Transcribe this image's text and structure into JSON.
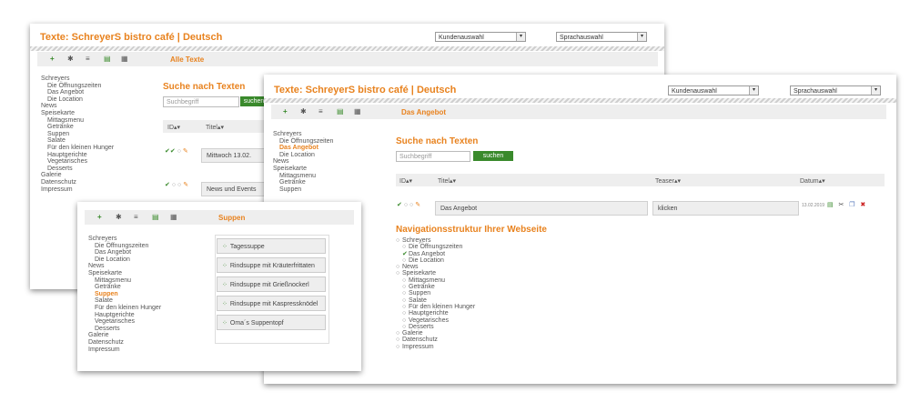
{
  "back_window": {
    "title": "Texte: SchreyerS bistro café | Deutsch",
    "customer_select": "Kundenauswahl",
    "language_select": "Sprachauswahl",
    "toolbar_title": "Alle Texte",
    "nav": [
      {
        "label": "Schreyers",
        "level": 1
      },
      {
        "label": "Die Öffnungszeiten",
        "level": 2
      },
      {
        "label": "Das Angebot",
        "level": 2
      },
      {
        "label": "Die Location",
        "level": 2
      },
      {
        "label": "News",
        "level": 1
      },
      {
        "label": "Speisekarte",
        "level": 1
      },
      {
        "label": "Mittagsmenu",
        "level": 2
      },
      {
        "label": "Getränke",
        "level": 2
      },
      {
        "label": "Suppen",
        "level": 2
      },
      {
        "label": "Salate",
        "level": 2
      },
      {
        "label": "Für den kleinen Hunger",
        "level": 2
      },
      {
        "label": "Hauptgerichte",
        "level": 2
      },
      {
        "label": "Vegetarisches",
        "level": 2
      },
      {
        "label": "Desserts",
        "level": 2
      },
      {
        "label": "Galerie",
        "level": 1
      },
      {
        "label": "Datenschutz",
        "level": 1
      },
      {
        "label": "Impressum",
        "level": 1
      }
    ],
    "search_heading": "Suche nach Texten",
    "search_placeholder": "Suchbegriff",
    "search_button": "suchen",
    "columns": {
      "id": "ID▴▾",
      "title": "Titel▴▾"
    },
    "rows": [
      {
        "title": "Mittwoch 13.02."
      },
      {
        "title": "News und Events"
      }
    ]
  },
  "main_window": {
    "title": "Texte: SchreyerS bistro café | Deutsch",
    "customer_select": "Kundenauswahl",
    "language_select": "Sprachauswahl",
    "toolbar_title": "Das Angebot",
    "nav": [
      {
        "label": "Schreyers",
        "level": 1
      },
      {
        "label": "Die Öffnungszeiten",
        "level": 2
      },
      {
        "label": "Das Angebot",
        "level": 2,
        "active": true
      },
      {
        "label": "Die Location",
        "level": 2
      },
      {
        "label": "News",
        "level": 1
      },
      {
        "label": "Speisekarte",
        "level": 1
      },
      {
        "label": "Mittagsmenu",
        "level": 2
      },
      {
        "label": "Getränke",
        "level": 2
      },
      {
        "label": "Suppen",
        "level": 2
      }
    ],
    "search_heading": "Suche nach Texten",
    "search_placeholder": "Suchbegriff",
    "search_button": "suchen",
    "columns": {
      "id": "ID▴▾",
      "title": "Titel▴▾",
      "teaser": "Teaser▴▾",
      "date": "Datum▴▾"
    },
    "row": {
      "title": "Das Angebot",
      "teaser": "klicken",
      "date": "13.02.2019"
    },
    "structure_heading": "Navigationsstruktur Ihrer Webseite",
    "tree": [
      {
        "label": "Schreyers",
        "level": 1
      },
      {
        "label": "Die Öffnungszeiten",
        "level": 2
      },
      {
        "label": "Das Angebot",
        "level": 2,
        "checked": true
      },
      {
        "label": "Die Location",
        "level": 2
      },
      {
        "label": "News",
        "level": 1
      },
      {
        "label": "Speisekarte",
        "level": 1
      },
      {
        "label": "Mittagsmenu",
        "level": 2
      },
      {
        "label": "Getränke",
        "level": 2
      },
      {
        "label": "Suppen",
        "level": 2
      },
      {
        "label": "Salate",
        "level": 2
      },
      {
        "label": "Für den kleinen Hunger",
        "level": 2
      },
      {
        "label": "Hauptgerichte",
        "level": 2
      },
      {
        "label": "Vegetarisches",
        "level": 2
      },
      {
        "label": "Desserts",
        "level": 2
      },
      {
        "label": "Galerie",
        "level": 1
      },
      {
        "label": "Datenschutz",
        "level": 1
      },
      {
        "label": "Impressum",
        "level": 1
      }
    ]
  },
  "front_window": {
    "toolbar_title": "Suppen",
    "nav": [
      {
        "label": "Schreyers",
        "level": 1
      },
      {
        "label": "Die Öffnungszeiten",
        "level": 2
      },
      {
        "label": "Das Angebot",
        "level": 2
      },
      {
        "label": "Die Location",
        "level": 2
      },
      {
        "label": "News",
        "level": 1
      },
      {
        "label": "Speisekarte",
        "level": 1
      },
      {
        "label": "Mittagsmenu",
        "level": 2
      },
      {
        "label": "Getränke",
        "level": 2
      },
      {
        "label": "Suppen",
        "level": 2,
        "active": true
      },
      {
        "label": "Salate",
        "level": 2
      },
      {
        "label": "Für den kleinen Hunger",
        "level": 2
      },
      {
        "label": "Hauptgerichte",
        "level": 2
      },
      {
        "label": "Vegetarisches",
        "level": 2
      },
      {
        "label": "Desserts",
        "level": 2
      },
      {
        "label": "Galerie",
        "level": 1
      },
      {
        "label": "Datenschutz",
        "level": 1
      },
      {
        "label": "Impressum",
        "level": 1
      }
    ],
    "items": [
      "Tagessuppe",
      "Rindsuppe mit Kräuterfrittaten",
      "Rindsuppe mit Grießnockerl",
      "Rindsuppe mit Kaspressknödel",
      "Oma´s Suppentopf"
    ]
  },
  "colors": {
    "accent": "#e8821e",
    "button": "#3a8a2c"
  },
  "icons": [
    "plus-icon",
    "gear-icon",
    "list-icon",
    "document-icon",
    "grid-icon",
    "check-icon",
    "edit-icon",
    "copy-icon",
    "delete-icon"
  ]
}
